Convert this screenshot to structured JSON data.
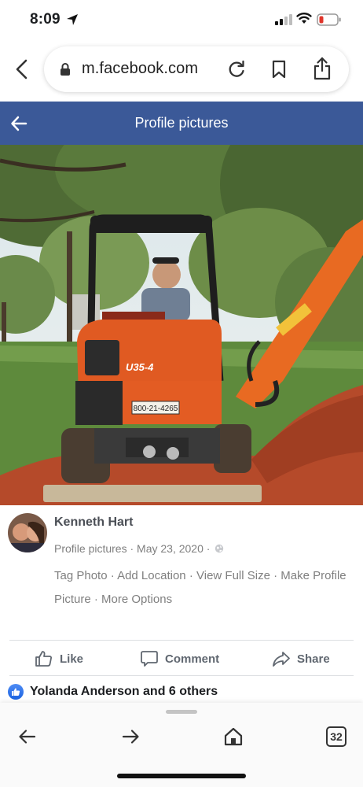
{
  "status": {
    "time": "8:09"
  },
  "browser": {
    "url": "m.facebook.com"
  },
  "header": {
    "title": "Profile pictures"
  },
  "photo": {
    "plate_text": "800-21-4265",
    "machine_model": "U35-4"
  },
  "post": {
    "author": "Kenneth Hart",
    "album": "Profile pictures",
    "date": "May 23, 2020",
    "links": [
      "Tag Photo",
      "Add Location",
      "View Full Size",
      "Make Profile Picture",
      "More Options"
    ]
  },
  "actions": {
    "like": "Like",
    "comment": "Comment",
    "share": "Share"
  },
  "reactions": {
    "text": "Yolanda Anderson and 6 others"
  },
  "toolbar": {
    "tab_count": "32"
  },
  "colors": {
    "fb_blue": "#3b5998",
    "link_gray": "#7f7f7f",
    "author": "#4b4f56",
    "like_blue": "#1a63e0",
    "battery_low": "#e0352b"
  }
}
